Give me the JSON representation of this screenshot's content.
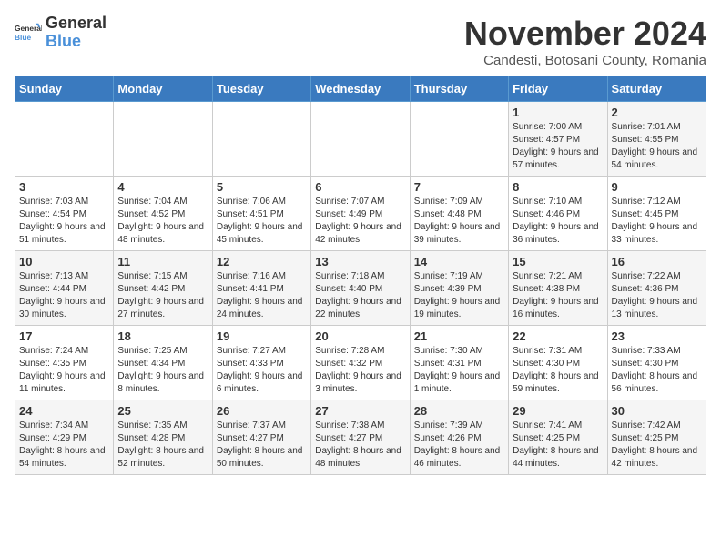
{
  "logo": {
    "line1": "General",
    "line2": "Blue"
  },
  "title": "November 2024",
  "subtitle": "Candesti, Botosani County, Romania",
  "weekdays": [
    "Sunday",
    "Monday",
    "Tuesday",
    "Wednesday",
    "Thursday",
    "Friday",
    "Saturday"
  ],
  "weeks": [
    [
      {
        "day": "",
        "info": ""
      },
      {
        "day": "",
        "info": ""
      },
      {
        "day": "",
        "info": ""
      },
      {
        "day": "",
        "info": ""
      },
      {
        "day": "",
        "info": ""
      },
      {
        "day": "1",
        "info": "Sunrise: 7:00 AM\nSunset: 4:57 PM\nDaylight: 9 hours and 57 minutes."
      },
      {
        "day": "2",
        "info": "Sunrise: 7:01 AM\nSunset: 4:55 PM\nDaylight: 9 hours and 54 minutes."
      }
    ],
    [
      {
        "day": "3",
        "info": "Sunrise: 7:03 AM\nSunset: 4:54 PM\nDaylight: 9 hours and 51 minutes."
      },
      {
        "day": "4",
        "info": "Sunrise: 7:04 AM\nSunset: 4:52 PM\nDaylight: 9 hours and 48 minutes."
      },
      {
        "day": "5",
        "info": "Sunrise: 7:06 AM\nSunset: 4:51 PM\nDaylight: 9 hours and 45 minutes."
      },
      {
        "day": "6",
        "info": "Sunrise: 7:07 AM\nSunset: 4:49 PM\nDaylight: 9 hours and 42 minutes."
      },
      {
        "day": "7",
        "info": "Sunrise: 7:09 AM\nSunset: 4:48 PM\nDaylight: 9 hours and 39 minutes."
      },
      {
        "day": "8",
        "info": "Sunrise: 7:10 AM\nSunset: 4:46 PM\nDaylight: 9 hours and 36 minutes."
      },
      {
        "day": "9",
        "info": "Sunrise: 7:12 AM\nSunset: 4:45 PM\nDaylight: 9 hours and 33 minutes."
      }
    ],
    [
      {
        "day": "10",
        "info": "Sunrise: 7:13 AM\nSunset: 4:44 PM\nDaylight: 9 hours and 30 minutes."
      },
      {
        "day": "11",
        "info": "Sunrise: 7:15 AM\nSunset: 4:42 PM\nDaylight: 9 hours and 27 minutes."
      },
      {
        "day": "12",
        "info": "Sunrise: 7:16 AM\nSunset: 4:41 PM\nDaylight: 9 hours and 24 minutes."
      },
      {
        "day": "13",
        "info": "Sunrise: 7:18 AM\nSunset: 4:40 PM\nDaylight: 9 hours and 22 minutes."
      },
      {
        "day": "14",
        "info": "Sunrise: 7:19 AM\nSunset: 4:39 PM\nDaylight: 9 hours and 19 minutes."
      },
      {
        "day": "15",
        "info": "Sunrise: 7:21 AM\nSunset: 4:38 PM\nDaylight: 9 hours and 16 minutes."
      },
      {
        "day": "16",
        "info": "Sunrise: 7:22 AM\nSunset: 4:36 PM\nDaylight: 9 hours and 13 minutes."
      }
    ],
    [
      {
        "day": "17",
        "info": "Sunrise: 7:24 AM\nSunset: 4:35 PM\nDaylight: 9 hours and 11 minutes."
      },
      {
        "day": "18",
        "info": "Sunrise: 7:25 AM\nSunset: 4:34 PM\nDaylight: 9 hours and 8 minutes."
      },
      {
        "day": "19",
        "info": "Sunrise: 7:27 AM\nSunset: 4:33 PM\nDaylight: 9 hours and 6 minutes."
      },
      {
        "day": "20",
        "info": "Sunrise: 7:28 AM\nSunset: 4:32 PM\nDaylight: 9 hours and 3 minutes."
      },
      {
        "day": "21",
        "info": "Sunrise: 7:30 AM\nSunset: 4:31 PM\nDaylight: 9 hours and 1 minute."
      },
      {
        "day": "22",
        "info": "Sunrise: 7:31 AM\nSunset: 4:30 PM\nDaylight: 8 hours and 59 minutes."
      },
      {
        "day": "23",
        "info": "Sunrise: 7:33 AM\nSunset: 4:30 PM\nDaylight: 8 hours and 56 minutes."
      }
    ],
    [
      {
        "day": "24",
        "info": "Sunrise: 7:34 AM\nSunset: 4:29 PM\nDaylight: 8 hours and 54 minutes."
      },
      {
        "day": "25",
        "info": "Sunrise: 7:35 AM\nSunset: 4:28 PM\nDaylight: 8 hours and 52 minutes."
      },
      {
        "day": "26",
        "info": "Sunrise: 7:37 AM\nSunset: 4:27 PM\nDaylight: 8 hours and 50 minutes."
      },
      {
        "day": "27",
        "info": "Sunrise: 7:38 AM\nSunset: 4:27 PM\nDaylight: 8 hours and 48 minutes."
      },
      {
        "day": "28",
        "info": "Sunrise: 7:39 AM\nSunset: 4:26 PM\nDaylight: 8 hours and 46 minutes."
      },
      {
        "day": "29",
        "info": "Sunrise: 7:41 AM\nSunset: 4:25 PM\nDaylight: 8 hours and 44 minutes."
      },
      {
        "day": "30",
        "info": "Sunrise: 7:42 AM\nSunset: 4:25 PM\nDaylight: 8 hours and 42 minutes."
      }
    ]
  ]
}
